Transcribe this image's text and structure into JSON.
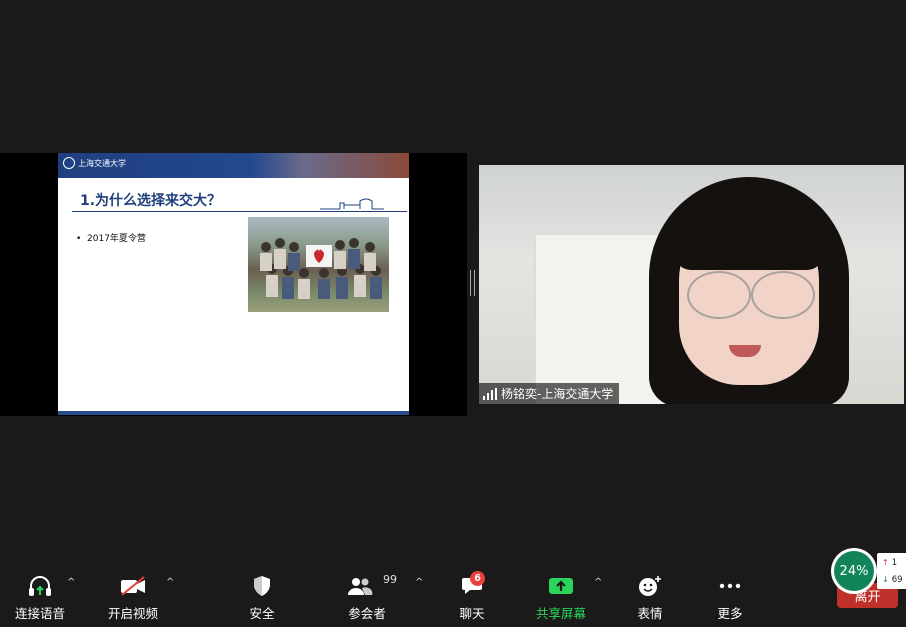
{
  "slide": {
    "logo_text": "上海交通大学",
    "title": "1.为什么选择来交大？",
    "bullet": "2017年夏令营"
  },
  "video": {
    "participant_name": "杨铭奕-上海交通大学"
  },
  "toolbar": {
    "audio_label": "连接语音",
    "video_label": "开启视频",
    "security_label": "安全",
    "participants_label": "参会者",
    "participants_count": "99",
    "chat_label": "聊天",
    "chat_badge": "6",
    "share_label": "共享屏幕",
    "reactions_label": "表情",
    "more_label": "更多",
    "leave_label": "离开"
  },
  "monitor": {
    "cpu_percent": "24%",
    "upload": "1",
    "download": "69"
  },
  "colors": {
    "share_green": "#2bd45a",
    "leave_red": "#c0302a",
    "badge_red": "#e8423a",
    "slide_blue": "#1e3f7c"
  }
}
